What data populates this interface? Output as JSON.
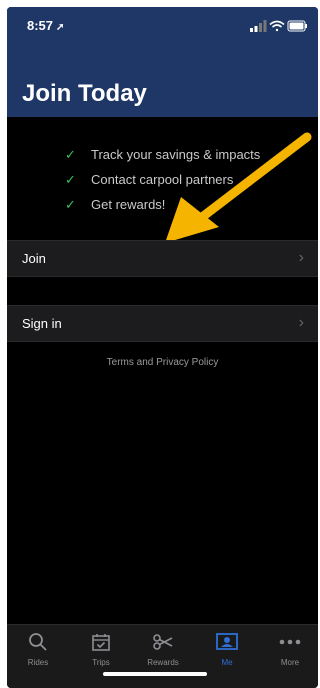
{
  "status_bar": {
    "time": "8:57",
    "location_arrow": "location-arrow-icon"
  },
  "header": {
    "title": "Join Today"
  },
  "benefits": [
    {
      "icon": "check-icon",
      "text": "Track your savings & impacts"
    },
    {
      "icon": "check-icon",
      "text": "Contact carpool partners"
    },
    {
      "icon": "check-icon",
      "text": "Get rewards!"
    }
  ],
  "actions": {
    "join_label": "Join",
    "sign_in_label": "Sign in",
    "chevron": "›"
  },
  "footer": {
    "terms_text": "Terms and Privacy Policy"
  },
  "tab_bar": {
    "active_tab": "Me",
    "tabs": [
      {
        "label": "Rides",
        "icon": "search-icon"
      },
      {
        "label": "Trips",
        "icon": "calendar-check-icon"
      },
      {
        "label": "Rewards",
        "icon": "coupon-scissors-icon"
      },
      {
        "label": "Me",
        "icon": "profile-card-icon"
      },
      {
        "label": "More",
        "icon": "more-dots-icon"
      }
    ]
  },
  "colors": {
    "header_bg": "#1e3766",
    "accent_arrow": "#f4b400",
    "check_green": "#3fbf5a",
    "tab_active": "#2f6fd6"
  }
}
